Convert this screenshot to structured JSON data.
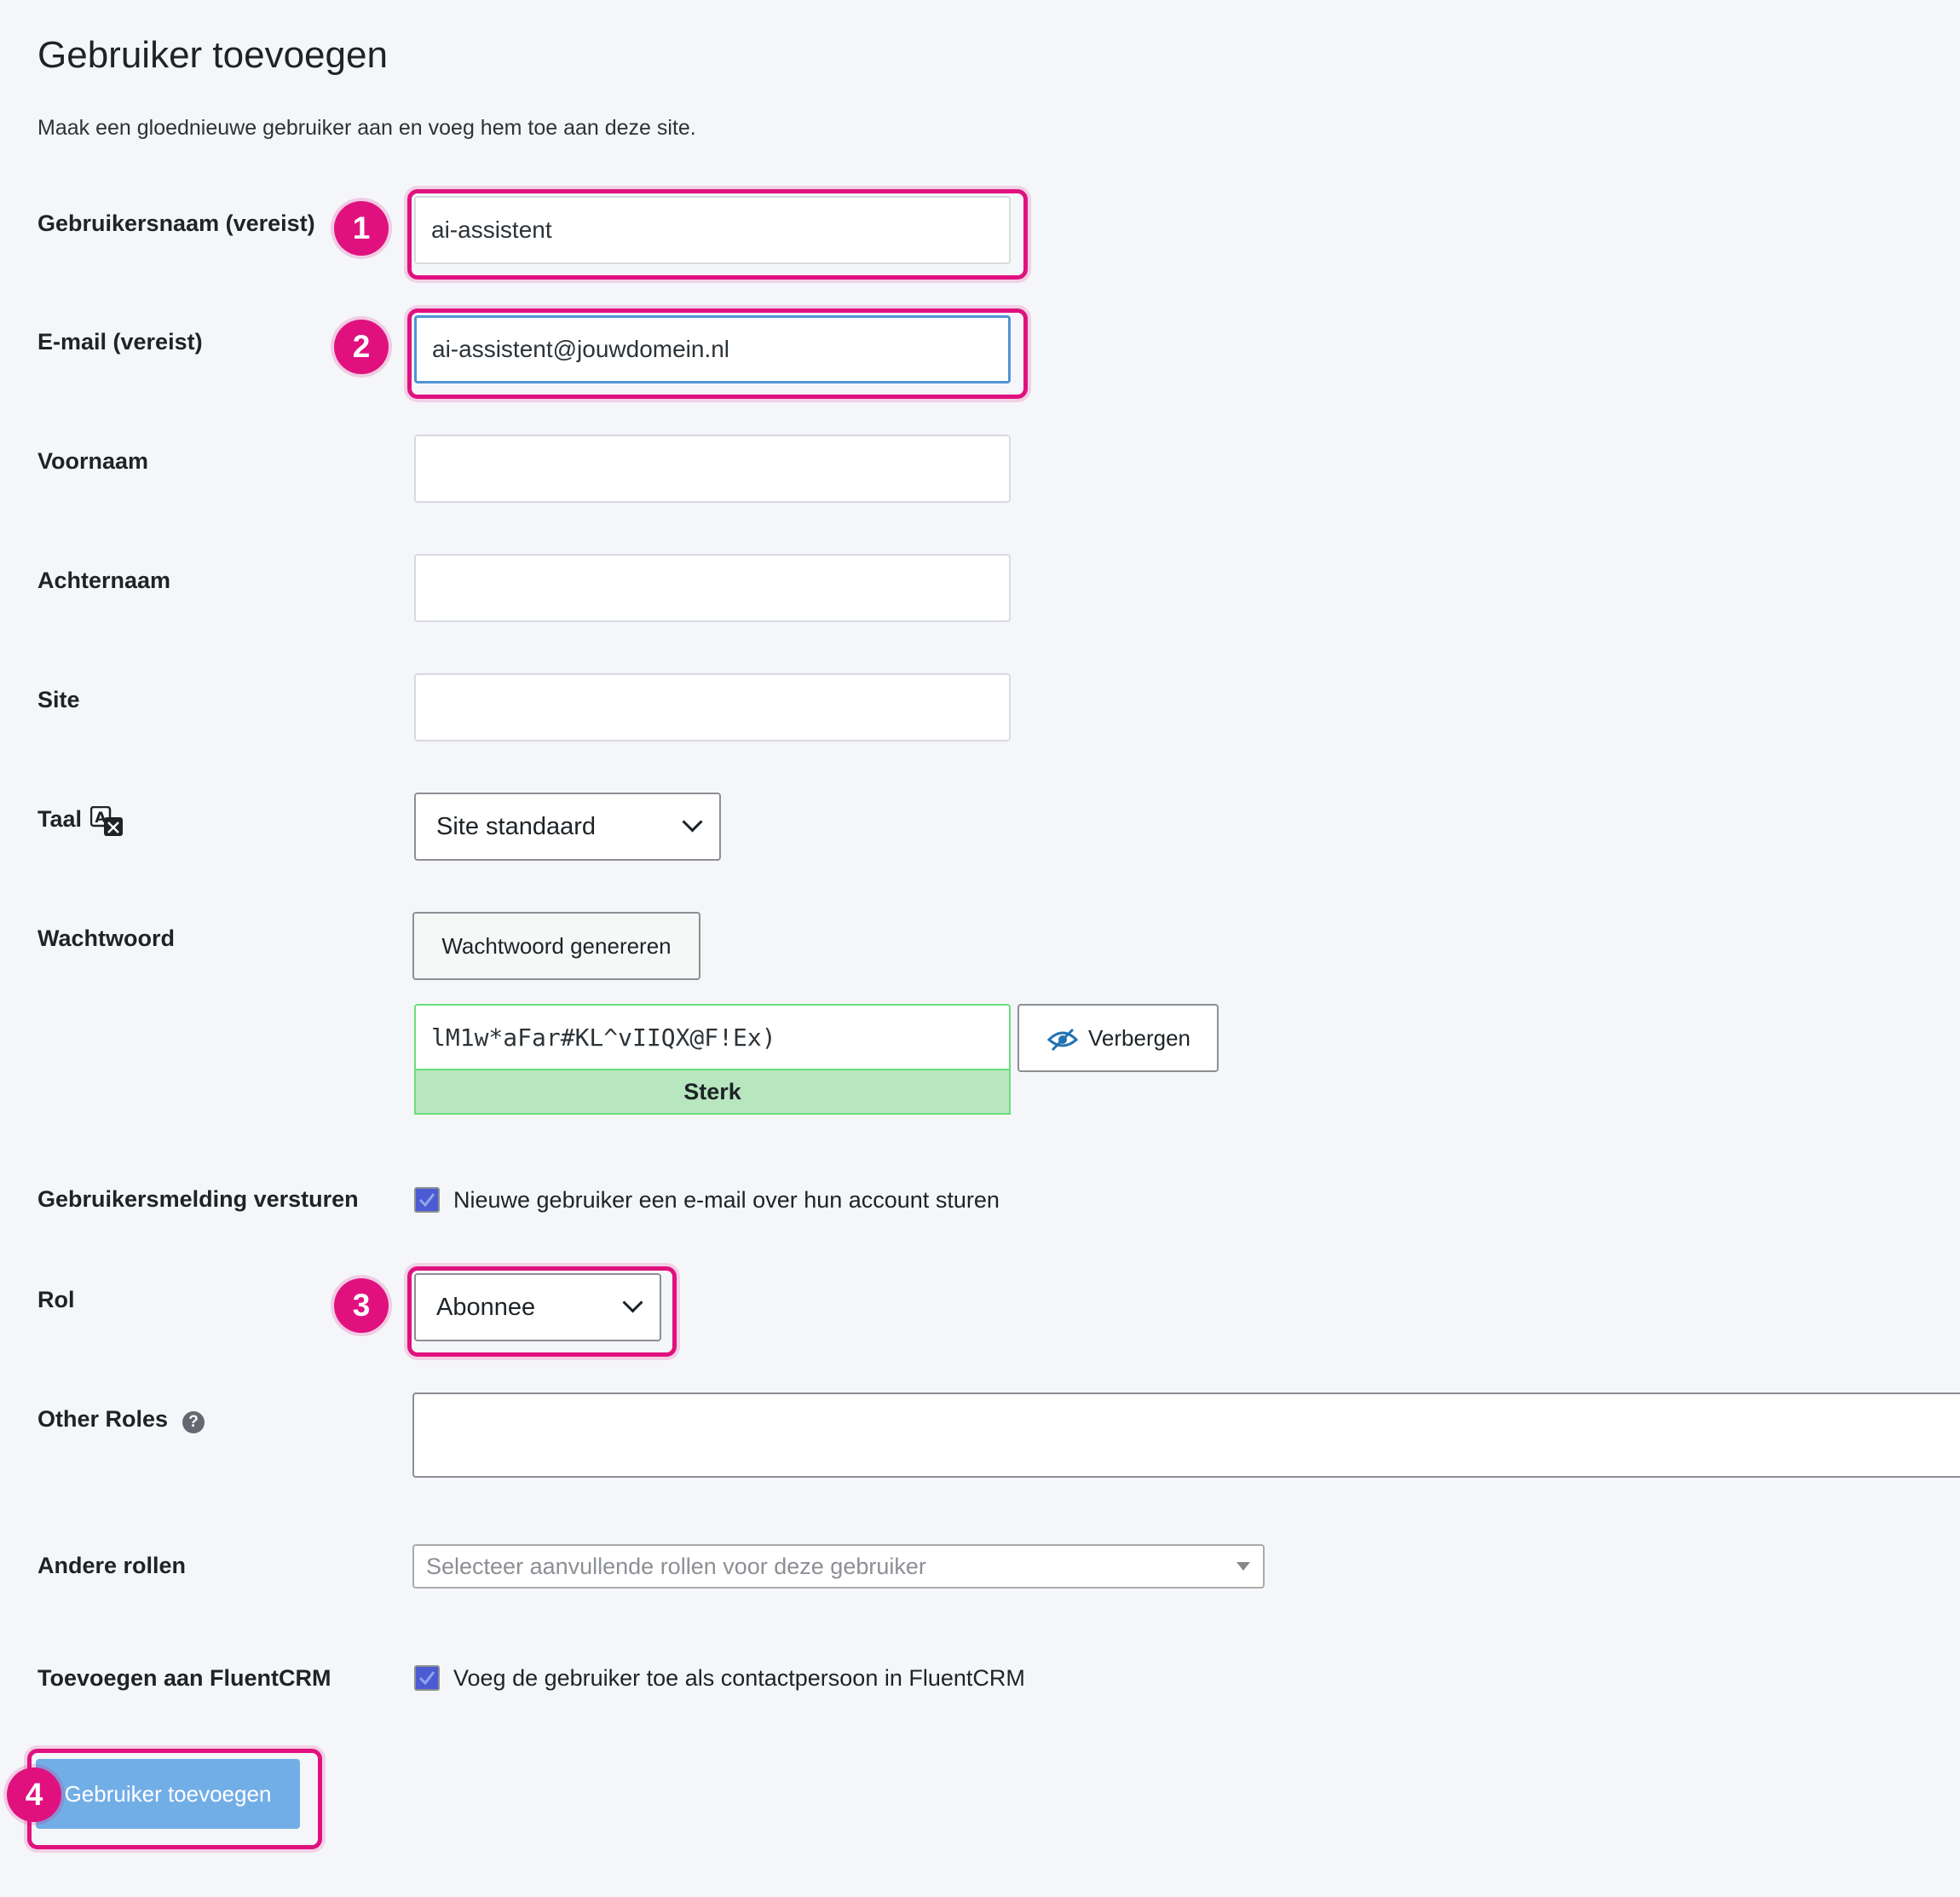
{
  "page": {
    "title": "Gebruiker toevoegen",
    "description": "Maak een gloednieuwe gebruiker aan en voeg hem toe aan deze site."
  },
  "annotations": {
    "badge_1": "1",
    "badge_2": "2",
    "badge_3": "3",
    "badge_4": "4",
    "highlight_color": "#e0117f"
  },
  "form": {
    "username": {
      "label": "Gebruikersnaam (vereist)",
      "value": "ai-assistent"
    },
    "email": {
      "label": "E-mail (vereist)",
      "value": "ai-assistent@jouwdomein.nl"
    },
    "first_name": {
      "label": "Voornaam",
      "value": ""
    },
    "last_name": {
      "label": "Achternaam",
      "value": ""
    },
    "website": {
      "label": "Site",
      "value": ""
    },
    "language": {
      "label": "Taal",
      "icon": "translate-icon",
      "selected": "Site standaard"
    },
    "password": {
      "label": "Wachtwoord",
      "generate_label": "Wachtwoord genereren",
      "value": "lM1w*aFar#KL^vIIQX@F!Ex)",
      "toggle_label": "Verbergen",
      "toggle_icon": "eye-slash-icon",
      "strength": "Sterk",
      "strength_color": "#b8e6bf"
    },
    "notification": {
      "label": "Gebruikersmelding versturen",
      "checkbox_label": "Nieuwe gebruiker een e-mail over hun account sturen",
      "checked": true
    },
    "role": {
      "label": "Rol",
      "selected": "Abonnee"
    },
    "other_roles": {
      "label": "Other Roles",
      "help_icon": "question-icon",
      "value": ""
    },
    "additional_roles": {
      "label": "Andere rollen",
      "placeholder": "Selecteer aanvullende rollen voor deze gebruiker"
    },
    "fluentcrm": {
      "label": "Toevoegen aan FluentCRM",
      "checkbox_label": "Voeg de gebruiker toe als contactpersoon in FluentCRM",
      "checked": true
    },
    "submit_label": "Gebruiker toevoegen"
  }
}
